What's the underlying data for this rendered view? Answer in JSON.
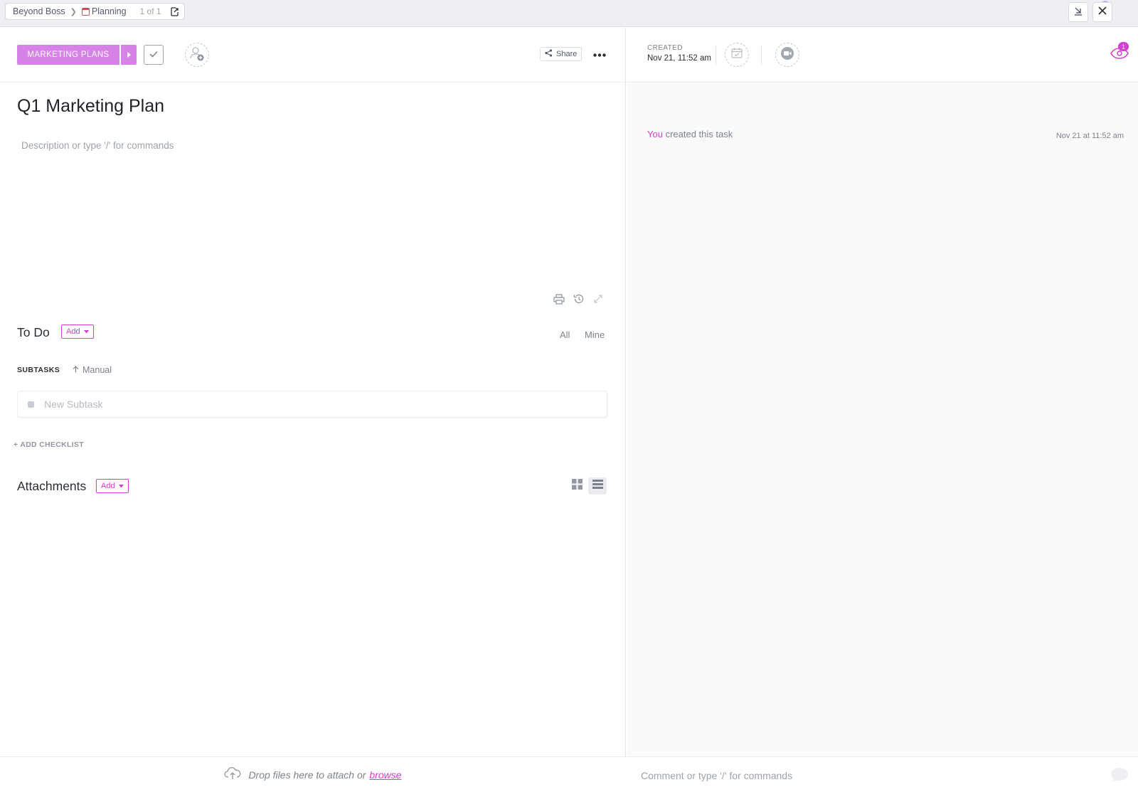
{
  "breadcrumb": {
    "workspace": "Beyond Boss",
    "list": "Planning",
    "position": "1 of 1"
  },
  "task": {
    "status": "MARKETING PLANS",
    "title": "Q1 Marketing Plan",
    "description_placeholder": "Description or type '/' for commands",
    "share_label": "Share"
  },
  "todo": {
    "title": "To Do",
    "add_label": "Add",
    "filter_all": "All",
    "filter_mine": "Mine"
  },
  "subtasks": {
    "label": "SUBTASKS",
    "sort": "Manual",
    "new_placeholder": "New Subtask",
    "add_checklist": "+ ADD CHECKLIST"
  },
  "attachments": {
    "title": "Attachments",
    "add_label": "Add",
    "drop_text": "Drop files here to attach or",
    "browse": "browse"
  },
  "details": {
    "created_label": "CREATED",
    "created_value": "Nov 21, 11:52 am",
    "watchers_count": "1"
  },
  "activity": {
    "actor": "You",
    "action": "created this task",
    "time": "Nov 21 at 11:52 am"
  },
  "comment": {
    "placeholder": "Comment or type '/' for commands"
  },
  "colors": {
    "accent": "#d63ed1",
    "status": "#d782e8",
    "notification": "#7b68ee"
  },
  "icons": [
    "chevron-right-icon",
    "calendar-icon",
    "export-icon",
    "minimize-icon",
    "close-icon",
    "check-icon",
    "add-assignee-icon",
    "share-icon",
    "more-icon",
    "print-icon",
    "history-icon",
    "expand-icon",
    "caret-down-icon",
    "arrow-up-icon",
    "grid-view-icon",
    "list-view-icon",
    "cloud-upload-icon",
    "due-date-icon",
    "video-icon",
    "eye-icon",
    "comment-bubble-icon"
  ]
}
